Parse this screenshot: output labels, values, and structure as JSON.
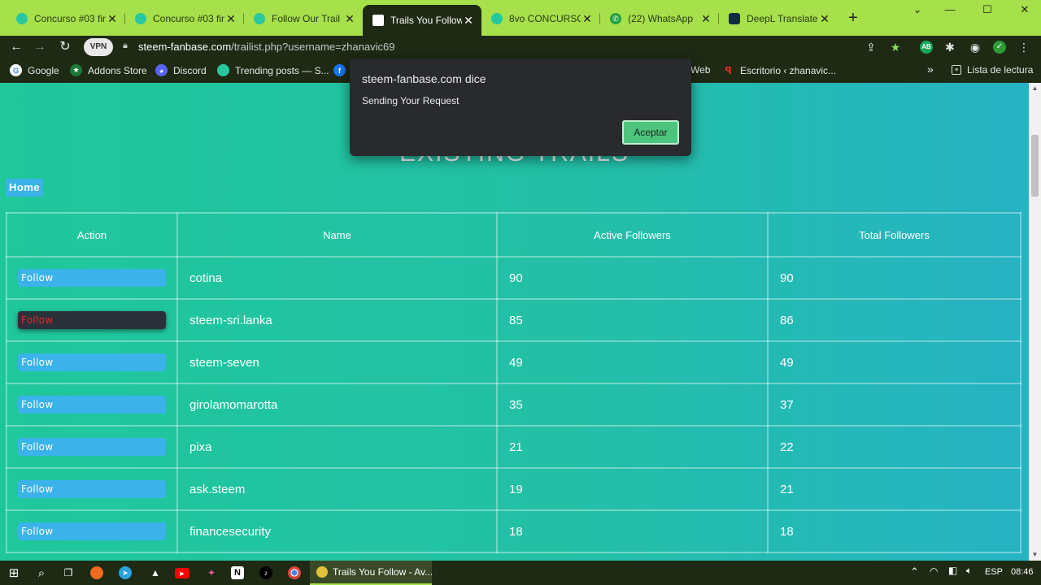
{
  "tabs": [
    {
      "label": "Concurso #03 fin",
      "icon": "steemit-icon",
      "close": "✕",
      "active": false
    },
    {
      "label": "Concurso #03 fin",
      "icon": "steemit-icon",
      "close": "✕",
      "active": false
    },
    {
      "label": "Follow Our Trail c",
      "icon": "steemit-icon",
      "close": "✕",
      "active": false
    },
    {
      "label": "Trails You Follow",
      "icon": "site-icon",
      "close": "✕",
      "active": true
    },
    {
      "label": "8vo CONCURSO",
      "icon": "steemit-icon",
      "close": "✕",
      "active": false
    },
    {
      "label": "(22) WhatsApp",
      "icon": "whatsapp-icon",
      "close": "✕",
      "active": false
    },
    {
      "label": "DeepL Translate",
      "icon": "deepl-icon",
      "close": "✕",
      "active": false
    }
  ],
  "new_tab": "+",
  "window_controls": [
    "⌄",
    "—",
    "☐",
    "✕"
  ],
  "toolbar": {
    "vpn": "VPN",
    "url_host": "steem-fanbase.com",
    "url_path": "/trailist.php?username=zhanavic69",
    "ext_ab": "AB"
  },
  "bookmarks": [
    {
      "label": "Google",
      "icon": "google-icon"
    },
    {
      "label": "Addons Store",
      "icon": "addons-icon"
    },
    {
      "label": "Discord",
      "icon": "discord-icon"
    },
    {
      "label": "Trending posts — S...",
      "icon": "steemit-icon"
    },
    {
      "label": "",
      "icon": "facebook-icon"
    },
    {
      "label": "Web",
      "icon": ""
    },
    {
      "label": "Escritorio ‹ zhanavic...",
      "icon": "wordpress-icon"
    }
  ],
  "bookmarks_more": "»",
  "reading_list": "Lista de lectura",
  "page": {
    "heading": "EXISTING TRAILS",
    "home_label": "Home",
    "columns": [
      "Action",
      "Name",
      "Active Followers",
      "Total Followers"
    ],
    "rows": [
      {
        "action": "Follow",
        "name": "cotina",
        "active": "90",
        "total": "90"
      },
      {
        "action": "Follow",
        "name": "steem-sri.lanka",
        "active": "85",
        "total": "86"
      },
      {
        "action": "Follow",
        "name": "steem-seven",
        "active": "49",
        "total": "49"
      },
      {
        "action": "Follow",
        "name": "girolamomarotta",
        "active": "35",
        "total": "37"
      },
      {
        "action": "Follow",
        "name": "pixa",
        "active": "21",
        "total": "22"
      },
      {
        "action": "Follow",
        "name": "ask.steem",
        "active": "19",
        "total": "21"
      },
      {
        "action": "Follow",
        "name": "financesecurity",
        "active": "18",
        "total": "18"
      }
    ]
  },
  "dialog": {
    "title": "steem-fanbase.com dice",
    "message": "Sending Your Request",
    "ok_label": "Aceptar"
  },
  "taskbar": {
    "active_app": "Trails You Follow - Av...",
    "language": "ESP",
    "time": "08:46"
  },
  "colors": {
    "browser_accent": "#a6e04a",
    "browser_dark": "#1e2a14",
    "follow_button": "#3bb3ea",
    "dialog_ok": "#4dc47e"
  }
}
